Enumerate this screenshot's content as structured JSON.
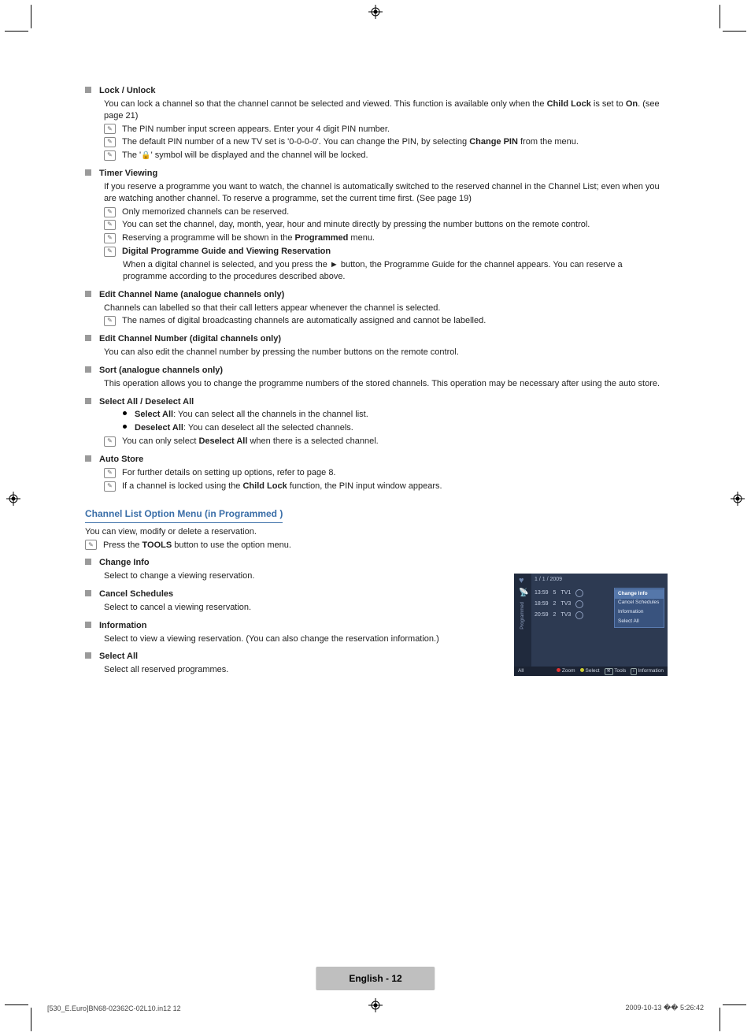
{
  "sections": {
    "lock_unlock": {
      "title": "Lock / Unlock",
      "intro_a": "You can lock a channel so that the channel cannot be selected and viewed. This function is available only when the ",
      "intro_bold": "Child Lock",
      "intro_b": " is set to ",
      "intro_bold2": "On",
      "intro_c": ". (see page 21)",
      "n1": "The PIN number input screen appears. Enter your 4 digit PIN number.",
      "n2a": "The default PIN number of a new TV set is '0-0-0-0'. You can change the PIN, by selecting ",
      "n2b": "Change PIN",
      "n2c": " from the menu.",
      "n3a": "The '",
      "n3b": "' symbol will be displayed and the channel will be locked."
    },
    "timer": {
      "title": "Timer Viewing",
      "intro": "If you reserve a programme you want to watch, the channel is automatically switched to the reserved channel in the Channel List; even when you are watching another channel. To reserve a programme, set the current time first. (See page 19)",
      "n1": "Only memorized channels can be reserved.",
      "n2": "You can set the channel, day, month, year, hour and minute directly by pressing the number buttons on the remote control.",
      "n3a": "Reserving a programme will be shown in the ",
      "n3b": "Programmed",
      "n3c": " menu.",
      "n4t": "Digital Programme Guide and Viewing Reservation",
      "n4": "When a digital channel is selected, and you press the ► button, the Programme Guide for the channel appears. You can reserve a programme according to the procedures described above."
    },
    "editName": {
      "title": "Edit Channel Name (analogue channels only)",
      "intro": "Channels can labelled so that their call letters appear whenever the channel is selected.",
      "n1": "The names of digital broadcasting channels are automatically assigned and cannot be labelled."
    },
    "editNumber": {
      "title": "Edit Channel Number (digital channels only)",
      "intro": "You can also edit the channel number by pressing the number buttons on the remote control."
    },
    "sort": {
      "title": "Sort (analogue channels only)",
      "intro": "This operation allows you to change the programme numbers of the stored channels. This operation may be necessary after using the auto store."
    },
    "selectAll": {
      "title": "Select All / Deselect All",
      "b1a": "Select All",
      "b1b": ": You can select all the channels in the channel list.",
      "b2a": "Deselect All",
      "b2b": ": You can deselect all the selected channels.",
      "n1a": "You can only select ",
      "n1b": "Deselect All",
      "n1c": " when there is a selected channel."
    },
    "autoStore": {
      "title": "Auto Store",
      "n1": "For further details on setting up options, refer to page 8.",
      "n2a": "If a channel is locked using the ",
      "n2b": "Child Lock",
      "n2c": " function, the PIN input window appears."
    }
  },
  "options": {
    "title": "Channel List Option Menu (in Programmed )",
    "intro": "You can view, modify or delete a reservation.",
    "n1a": "Press the ",
    "n1b": "TOOLS",
    "n1c": " button to use the option menu.",
    "items": {
      "changeInfo": {
        "title": "Change Info",
        "body": "Select to change a viewing reservation."
      },
      "cancelSchedules": {
        "title": "Cancel Schedules",
        "body": "Select to cancel a viewing reservation."
      },
      "information": {
        "title": "Information",
        "body": "Select to view a viewing reservation. (You can also change the reservation information.)"
      },
      "selectAll": {
        "title": "Select All",
        "body": "Select all reserved programmes."
      }
    }
  },
  "tv": {
    "sidebar_label": "Programmed",
    "all": "All",
    "date": "1 / 1 / 2009",
    "rows": [
      {
        "time": "13:59",
        "ch": "5",
        "name": "TV1"
      },
      {
        "time": "18:59",
        "ch": "2",
        "name": "TV3"
      },
      {
        "time": "20:59",
        "ch": "2",
        "name": "TV3"
      }
    ],
    "menu": [
      "Change Info",
      "Cancel Schedules",
      "Information",
      "Select All"
    ],
    "bottom": {
      "zoom": "Zoom",
      "select": "Select",
      "tools": "Tools",
      "info": "Information"
    }
  },
  "footer": {
    "pill": "English - 12",
    "left": "[530_E.Euro]BN68-02362C-02L10.in12   12",
    "right": "2009-10-13   �� 5:26:42"
  }
}
